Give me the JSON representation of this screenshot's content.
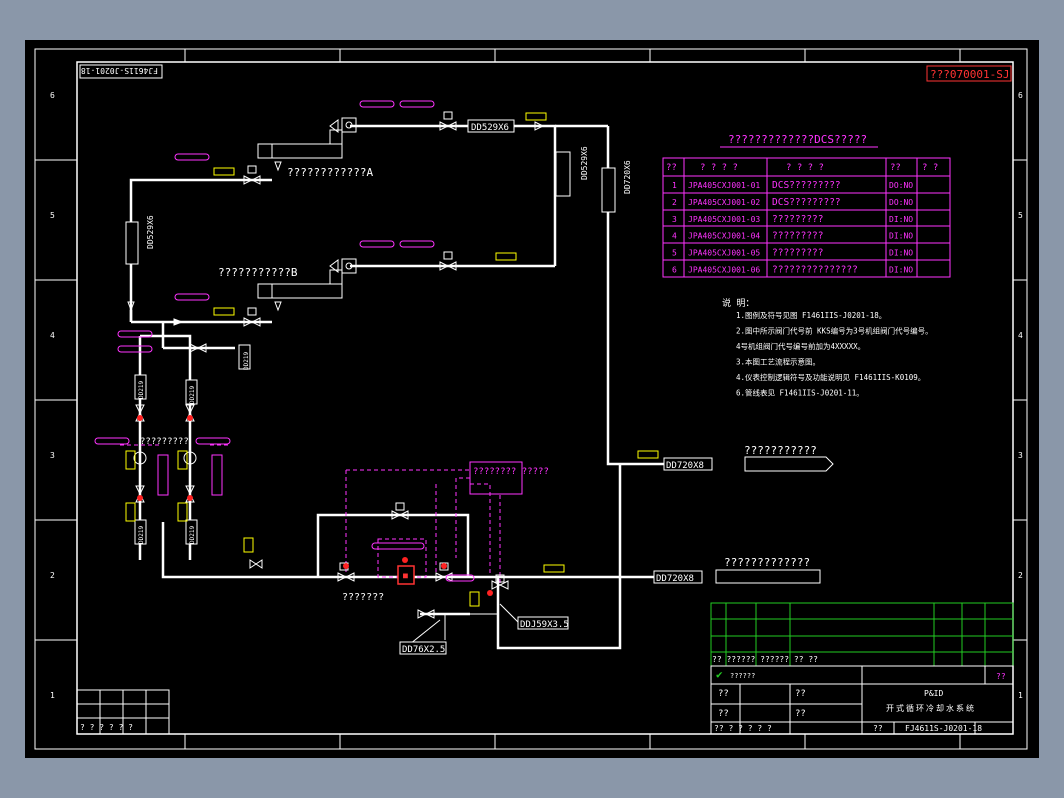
{
  "sheet": {
    "top_left_code": "FJ4611S-J0201-18",
    "top_right_code": "???070001-SJ"
  },
  "title_header": "?????????????DCS?????",
  "table": {
    "headers": [
      "??",
      "? ? ? ?",
      "? ? ? ?",
      "??",
      "? ?"
    ],
    "rows": [
      [
        "1",
        "JPA405CXJ001-01",
        "DCS?????????",
        "DO:NO",
        ""
      ],
      [
        "2",
        "JPA405CXJ001-02",
        "DCS?????????",
        "DO:NO",
        ""
      ],
      [
        "3",
        "JPA405CXJ001-03",
        "?????????",
        "DI:NO",
        ""
      ],
      [
        "4",
        "JPA405CXJ001-04",
        "?????????",
        "DI:NO",
        ""
      ],
      [
        "5",
        "JPA405CXJ001-05",
        "?????????",
        "DI:NO",
        ""
      ],
      [
        "6",
        "JPA405CXJ001-06",
        "???????????????",
        "DI:NO",
        ""
      ]
    ]
  },
  "notes": {
    "heading": "说 明：",
    "lines": [
      "1.图例及符号见图 F1461IIS-J0201-18。",
      "2.图中所示阀门代号前 KKS编号为3号机组阀门代号编号。",
      "  4号机组阀门代号编号前加为4XXXXX。",
      "3.本图工艺流程示意图。",
      "4.仪表控制逻辑符号及功能说明见 F1461IIS-K0109。",
      "6.管线表见 F1461IIS-J0201-11。"
    ]
  },
  "pipes": {
    "p1": "DD529X6",
    "p2": "DD529X6",
    "p3": "DD720X6",
    "p4": "DD529X6",
    "p5": "DD720X8",
    "p6": "DD720X8",
    "p7": "DDJ59X3.5",
    "p8": "DD76X2.5",
    "small1": "DD219",
    "small2": "DD219",
    "vert1": "DD219",
    "vert2": "DD219",
    "vert3": "DD219"
  },
  "equipment": {
    "a_label": "????????????A",
    "b_label": "???????????B",
    "dest1": "???????????",
    "dest2": "?????????????",
    "left_group": "?????????",
    "bottom_left": "???????",
    "control_box": "????????\n?????"
  },
  "title_block": {
    "row_label": "?? ?????? ?????? ?? ??",
    "logo_text": "??????",
    "cells": [
      "??",
      "??",
      "??",
      "??",
      "?? ? ? ? ? ?"
    ],
    "project": "P&ID",
    "drawing_name": "开式循环冷却水系统",
    "drawing_no": "FJ4611S-J0201-18",
    "scale": "??",
    "left_row": "? ? ? ? ? ?"
  }
}
